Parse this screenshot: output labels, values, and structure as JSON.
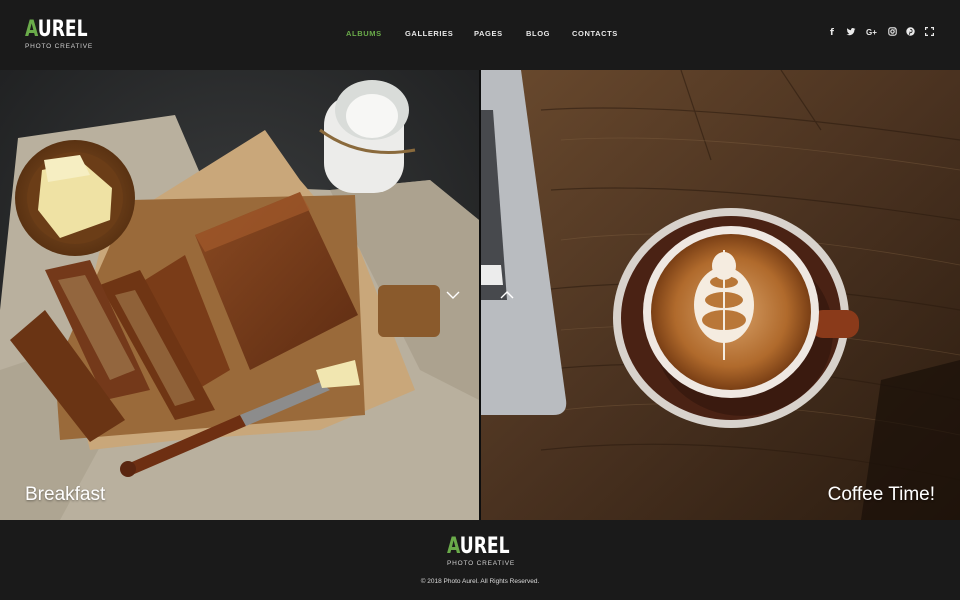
{
  "brand": {
    "logo_first_letter": "A",
    "logo_rest": "UREL",
    "tagline": "PHOTO CREATIVE",
    "accent_color": "#6aab4a"
  },
  "nav": {
    "items": [
      {
        "label": "ALBUMS",
        "active": true
      },
      {
        "label": "GALLERIES",
        "active": false
      },
      {
        "label": "PAGES",
        "active": false
      },
      {
        "label": "BLOG",
        "active": false
      },
      {
        "label": "CONTACTS",
        "active": false
      }
    ]
  },
  "social": {
    "icons": [
      {
        "name": "facebook-icon",
        "glyph": "f"
      },
      {
        "name": "twitter-icon",
        "glyph": "t"
      },
      {
        "name": "google-plus-icon",
        "glyph": "G+"
      },
      {
        "name": "instagram-icon",
        "glyph": "ig"
      },
      {
        "name": "pinterest-icon",
        "glyph": "p"
      },
      {
        "name": "fullscreen-icon",
        "glyph": "fs"
      }
    ]
  },
  "panels": {
    "left": {
      "caption": "Breakfast",
      "arrow": "chevron-down-icon"
    },
    "right": {
      "caption": "Coffee Time!",
      "arrow": "chevron-up-icon"
    }
  },
  "footer": {
    "logo_first_letter": "A",
    "logo_rest": "UREL",
    "tagline": "PHOTO CREATIVE",
    "copyright": "© 2018 Photo Aurel. All Rights Reserved."
  }
}
